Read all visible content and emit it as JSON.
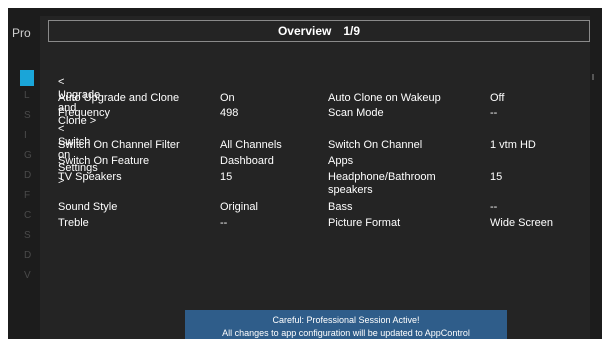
{
  "background": {
    "title": "Pro",
    "sidebar_ghost_letters": [
      "L",
      "S",
      "I",
      "G",
      "D",
      "F",
      "C",
      "S",
      "D",
      "V"
    ]
  },
  "overlay": {
    "title": "Overview",
    "page": "1/9",
    "rows": [
      {
        "type": "section",
        "label": "< Upgrade and Clone >"
      },
      {
        "type": "item",
        "label": "Auto Upgrade and Clone",
        "value": "On",
        "label2": "Auto Clone on Wakeup",
        "value2": "Off"
      },
      {
        "type": "item",
        "label": "Frequency",
        "value": "498",
        "label2": "Scan Mode",
        "value2": "--"
      },
      {
        "type": "section",
        "label": "< Switch on Settings >"
      },
      {
        "type": "item",
        "label": "Switch On Channel Filter",
        "value": "All Channels",
        "label2": "Switch On Channel",
        "value2": "1 vtm HD"
      },
      {
        "type": "item",
        "label": "Switch On Feature",
        "value": "Dashboard",
        "label2": "Apps",
        "value2": ""
      },
      {
        "type": "item",
        "label": "TV Speakers",
        "value": "15",
        "label2": "Headphone/Bathroom speakers",
        "value2": "15"
      },
      {
        "type": "item",
        "label": "Sound Style",
        "value": "Original",
        "label2": "Bass",
        "value2": "--"
      },
      {
        "type": "item",
        "label": "Treble",
        "value": "--",
        "label2": "Picture Format",
        "value2": "Wide Screen"
      }
    ],
    "banner_line1": "Careful: Professional Session Active!",
    "banner_line2": "All changes to app configuration will be updated to AppControl"
  },
  "colors": {
    "accent": "#1aa5d8",
    "banner": "#2f5d8a",
    "overlay_bg": "#242424"
  }
}
